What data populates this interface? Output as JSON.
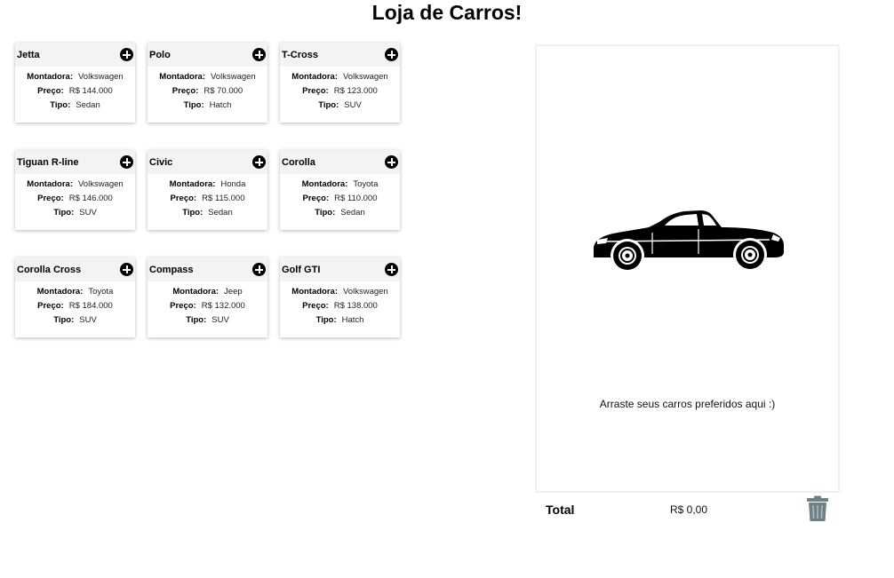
{
  "page": {
    "title": "Loja de Carros!"
  },
  "labels": {
    "brand": "Montadora:",
    "price": "Preço:",
    "type": "Tipo:"
  },
  "cars": [
    {
      "name": "Jetta",
      "brand": "Volkswagen",
      "price": "R$ 144.000",
      "type": "Sedan"
    },
    {
      "name": "Polo",
      "brand": "Volkswagen",
      "price": "R$ 70.000",
      "type": "Hatch"
    },
    {
      "name": "T-Cross",
      "brand": "Volkswagen",
      "price": "R$ 123.000",
      "type": "SUV"
    },
    {
      "name": "Tiguan R-line",
      "brand": "Volkswagen",
      "price": "R$ 146.000",
      "type": "SUV"
    },
    {
      "name": "Civic",
      "brand": "Honda",
      "price": "R$ 115.000",
      "type": "Sedan"
    },
    {
      "name": "Corolla",
      "brand": "Toyota",
      "price": "R$ 110.000",
      "type": "Sedan"
    },
    {
      "name": "Corolla Cross",
      "brand": "Toyota",
      "price": "R$ 184.000",
      "type": "SUV"
    },
    {
      "name": "Compass",
      "brand": "Jeep",
      "price": "R$ 132.000",
      "type": "SUV"
    },
    {
      "name": "Golf GTI",
      "brand": "Volkswagen",
      "price": "R$ 138.000",
      "type": "Hatch"
    }
  ],
  "cart": {
    "placeholder": "Arraste seus carros preferidos aqui :)",
    "total_label": "Total",
    "total_value": "R$ 0,00",
    "illustration_icon": "car-silhouette-icon",
    "clear_icon": "trash-icon",
    "clear_icon_color": "#6e7f86"
  }
}
